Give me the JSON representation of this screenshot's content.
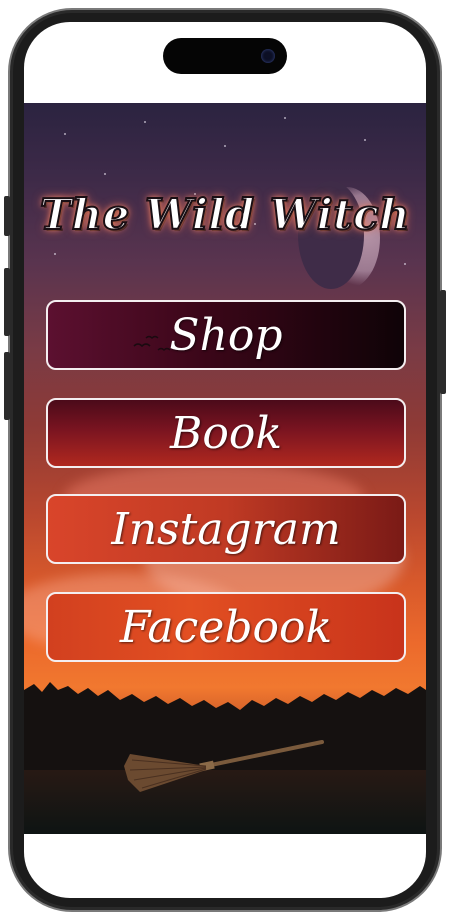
{
  "app": {
    "title": "The Wild Witch"
  },
  "links": [
    {
      "label": "Shop"
    },
    {
      "label": "Book"
    },
    {
      "label": "Instagram"
    },
    {
      "label": "Facebook"
    }
  ],
  "icons": {
    "camera": "front-camera-icon",
    "moon": "crescent-moon-icon",
    "birds": "birds-icon",
    "broom": "broomstick-icon",
    "trees": "treeline-silhouette"
  },
  "colors": {
    "sky_top": "#2b2340",
    "sky_sunset": "#ec6a2c",
    "button_border": "#f4eef0",
    "title_glow": "#f08a6a"
  }
}
